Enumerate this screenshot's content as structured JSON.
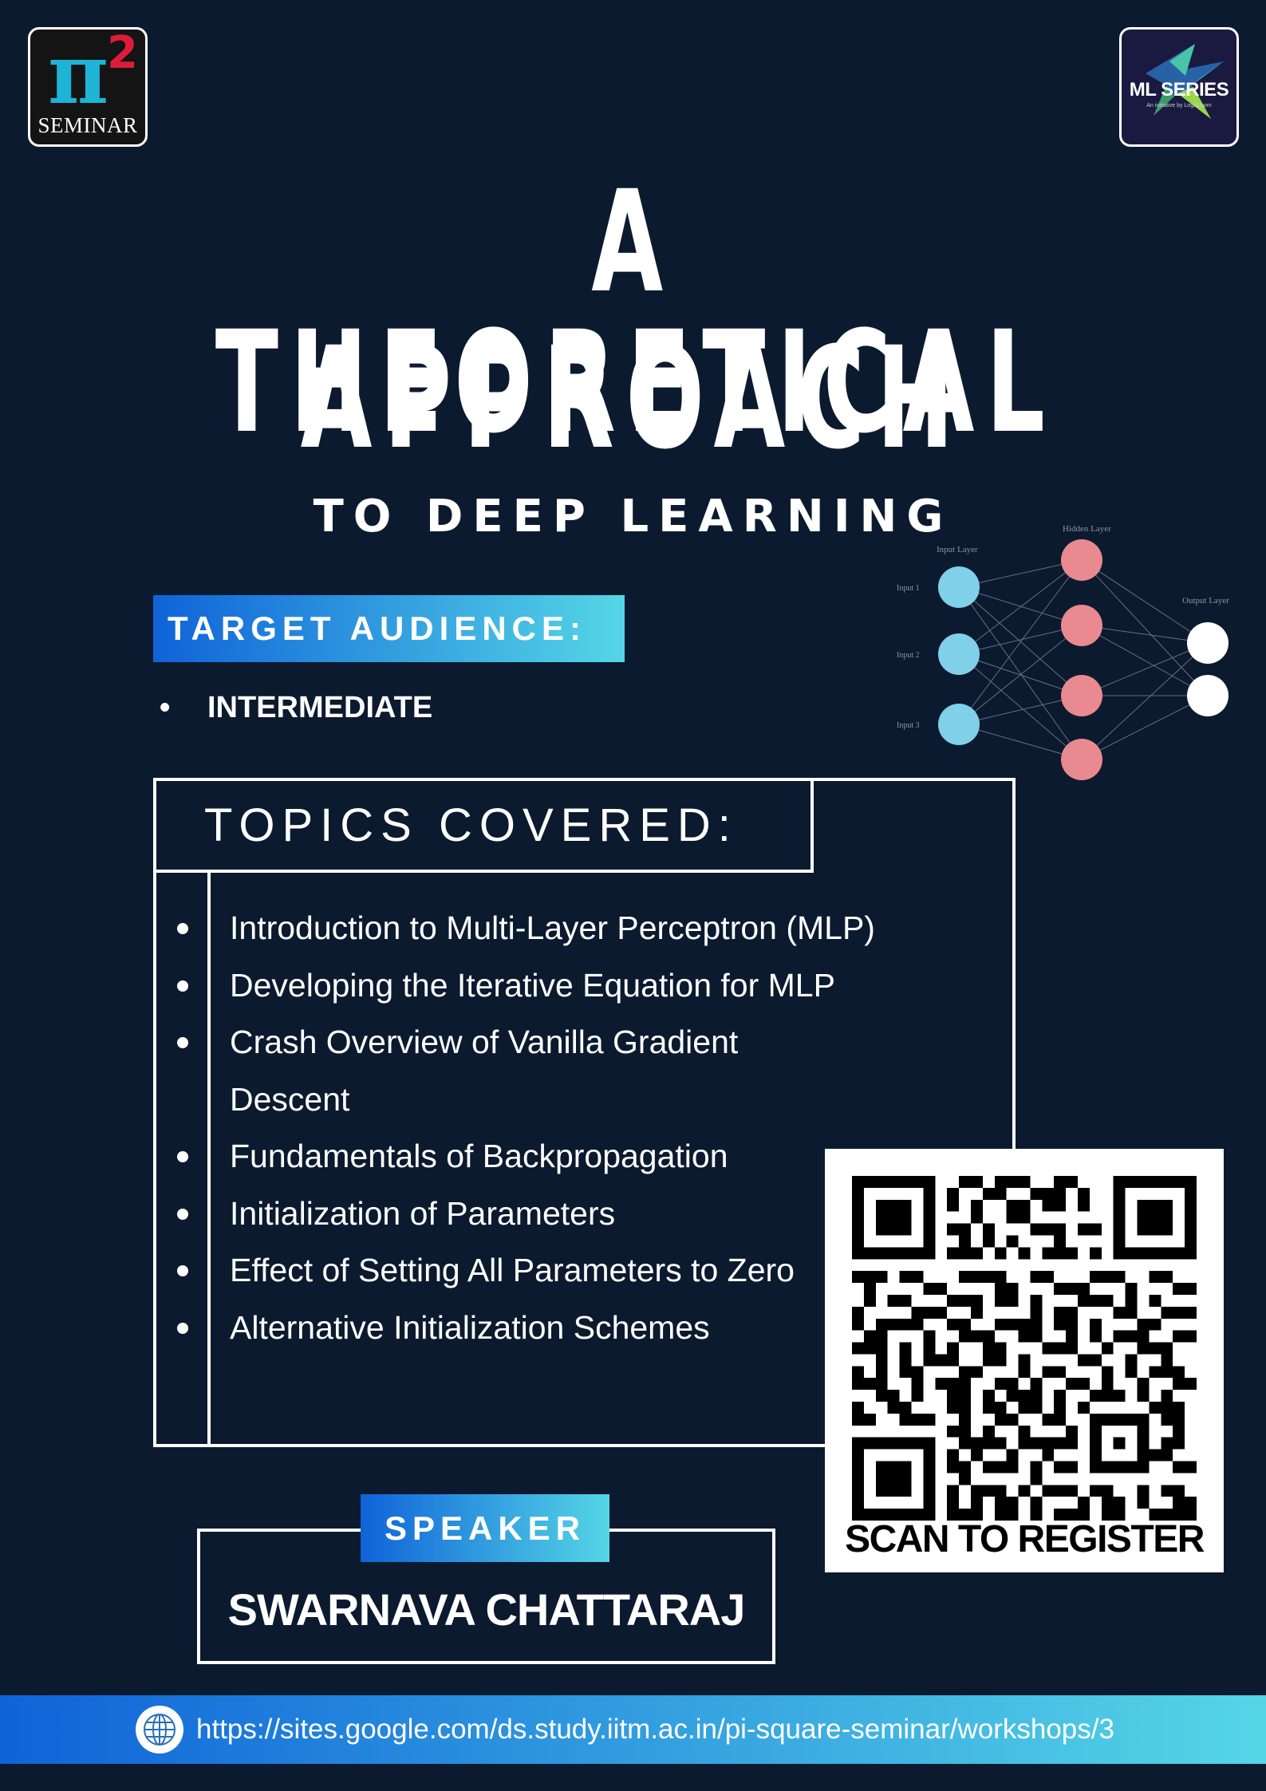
{
  "logos": {
    "left": {
      "glyph": "π",
      "superscript": "2",
      "label": "SEMINAR",
      "icon": "pi-square-seminar-logo"
    },
    "right": {
      "label": "ML SERIES",
      "sublabel": "An initiative by LogicLoom",
      "icon": "ml-series-logo"
    }
  },
  "headline": {
    "line1": "A THEORETICAL",
    "line2": "APPROACH",
    "line3": "TO DEEP LEARNING"
  },
  "audience": {
    "label": "TARGET AUDIENCE:",
    "items": [
      "INTERMEDIATE"
    ]
  },
  "topics": {
    "label": "TOPICS COVERED:",
    "items": [
      "Introduction to Multi-Layer Perceptron (MLP)",
      "Developing the Iterative Equation for MLP",
      "Crash Overview of Vanilla Gradient Descent",
      "Fundamentals of Backpropagation",
      "Initialization of Parameters",
      "Effect of Setting All Parameters to Zero",
      "Alternative Initialization Schemes"
    ]
  },
  "network_diagram": {
    "layers": [
      {
        "label": "Input Layer",
        "nodes": [
          "Input 1",
          "Input 2",
          "Input 3"
        ],
        "color": "#7fd0e8"
      },
      {
        "label": "Hidden Layer",
        "nodes": [
          "",
          "",
          "",
          ""
        ],
        "color": "#e88a90"
      },
      {
        "label": "Output Layer",
        "nodes": [
          "",
          ""
        ],
        "color": "#ffffff"
      }
    ]
  },
  "register": {
    "label": "SCAN TO REGISTER",
    "icon": "qr-code"
  },
  "speaker": {
    "label": "SPEAKER",
    "name": "SWARNAVA CHATTARAJ"
  },
  "footer": {
    "url": "https://sites.google.com/ds.study.iitm.ac.in/pi-square-seminar/workshops/3",
    "icon": "globe-icon"
  },
  "colors": {
    "background": "#0c1a2f",
    "gradient_start": "#0f63d8",
    "gradient_end": "#55d6e6"
  }
}
